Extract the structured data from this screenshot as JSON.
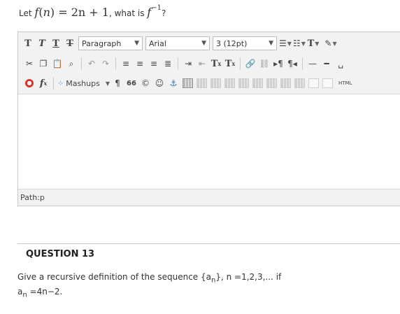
{
  "prev_question": {
    "prefix": "Let ",
    "func": "f",
    "arg": "n",
    "rhs": " = 2n + 1",
    "middle": ", what is ",
    "func2": "f",
    "power": "−1",
    "suffix": "?"
  },
  "toolbar": {
    "row1": {
      "bold": "T",
      "italic": "T",
      "underline": "T",
      "strike": "T",
      "format_select": "Paragraph",
      "font_select": "Arial",
      "size_select": "3 (12pt)",
      "text_color": "T"
    },
    "row2": {
      "superscript": "T",
      "sup_mark": "x",
      "subscript": "T",
      "sub_mark": "x"
    },
    "row3": {
      "mashups": "Mashups",
      "quote": "66",
      "copyright": "©",
      "fx": "f",
      "fx_sub": "x",
      "html": "HTML"
    }
  },
  "editor": {
    "path_label": "Path:",
    "path_value": " p"
  },
  "question": {
    "heading": "QUESTION 13",
    "line1_a": "Give a recursive definition of the sequence {a",
    "line1_sub": "n",
    "line1_b": "}, n =1,2,3,... if",
    "line2_a": "a",
    "line2_sub": "n",
    "line2_b": " =4n−2."
  }
}
